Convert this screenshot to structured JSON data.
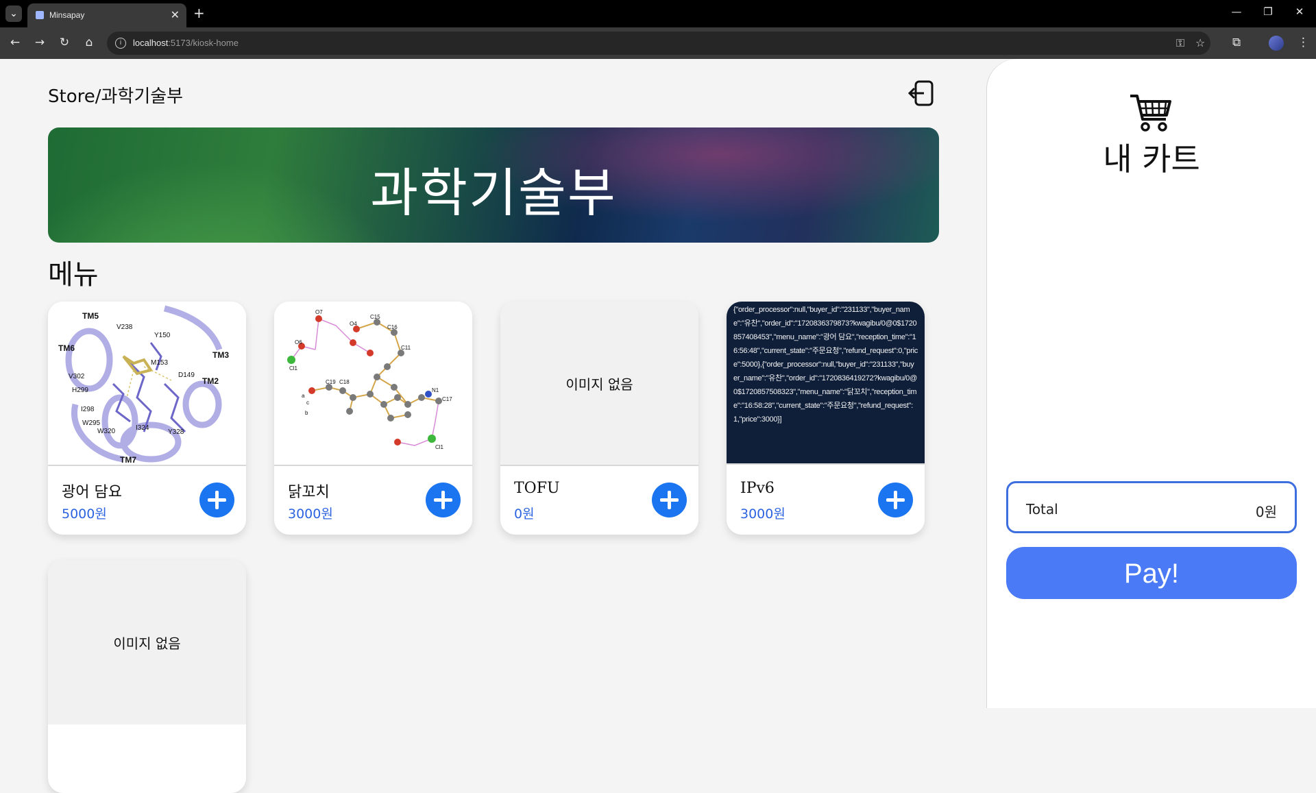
{
  "browser": {
    "tab_title": "Minsapay",
    "url_host": "localhost",
    "url_rest": ":5173/kiosk-home"
  },
  "store": {
    "title": "Store/과학기술부",
    "banner_title": "과학기술부"
  },
  "menu": {
    "heading": "메뉴",
    "no_image_label": "이미지 없음",
    "items": [
      {
        "name": "광어 담요",
        "price": "5000원",
        "image": "molecular-structure-diagram"
      },
      {
        "name": "닭꼬치",
        "price": "3000원",
        "image": "chemical-molecule-diagram"
      },
      {
        "name": "TOFU",
        "price": "0원",
        "image": "none"
      },
      {
        "name": "IPv6",
        "price": "3000원",
        "image": "json-text-screenshot"
      },
      {
        "name": "",
        "price": "",
        "image": "none"
      }
    ],
    "json_image_text": "{\"order_processor\":null,\"buyer_id\":\"231133\",\"buyer_name\":\"유찬\",\"order_id\":\"1720836379873?kwagibu/0@0$1720857408453\",\"menu_name\":\"광어 담요\",\"reception_time\":\"16:56:48\",\"current_state\":\"주문요청\",\"refund_request\":0,\"price\":5000},{\"order_processor\":null,\"buyer_id\":\"231133\",\"buyer_name\":\"유찬\",\"order_id\":\"1720836419272?kwagibu/0@0$1720857508323\",\"menu_name\":\"닭꼬치\",\"reception_time\":\"16:58:28\",\"current_state\":\"주문요청\",\"refund_request\":1,\"price\":3000}]"
  },
  "cart": {
    "title": "내 카트",
    "total_label": "Total",
    "total_value": "0원",
    "pay_label": "Pay!"
  },
  "colors": {
    "accent": "#1b74f0",
    "price": "#2b63e0",
    "pay": "#4a7af5"
  }
}
